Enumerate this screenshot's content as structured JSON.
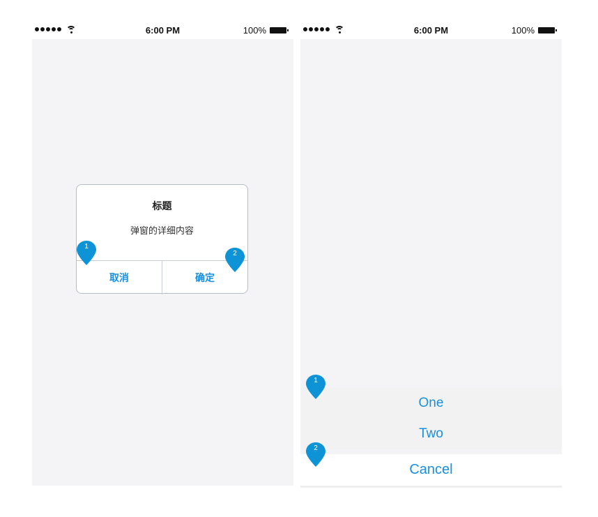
{
  "status_bar": {
    "time": "6:00 PM",
    "battery": "100%"
  },
  "dialog": {
    "title": "标题",
    "content": "弹窗的详细内容",
    "cancel_label": "取消",
    "confirm_label": "确定"
  },
  "action_sheet": {
    "options": [
      "One",
      "Two"
    ],
    "cancel_label": "Cancel"
  },
  "markers": {
    "dialog": [
      "1",
      "2"
    ],
    "sheet": [
      "1",
      "2"
    ]
  },
  "colors": {
    "accent": "#1a8fde",
    "pin": "#0e93d6",
    "screen_bg": "#f4f4f7"
  }
}
